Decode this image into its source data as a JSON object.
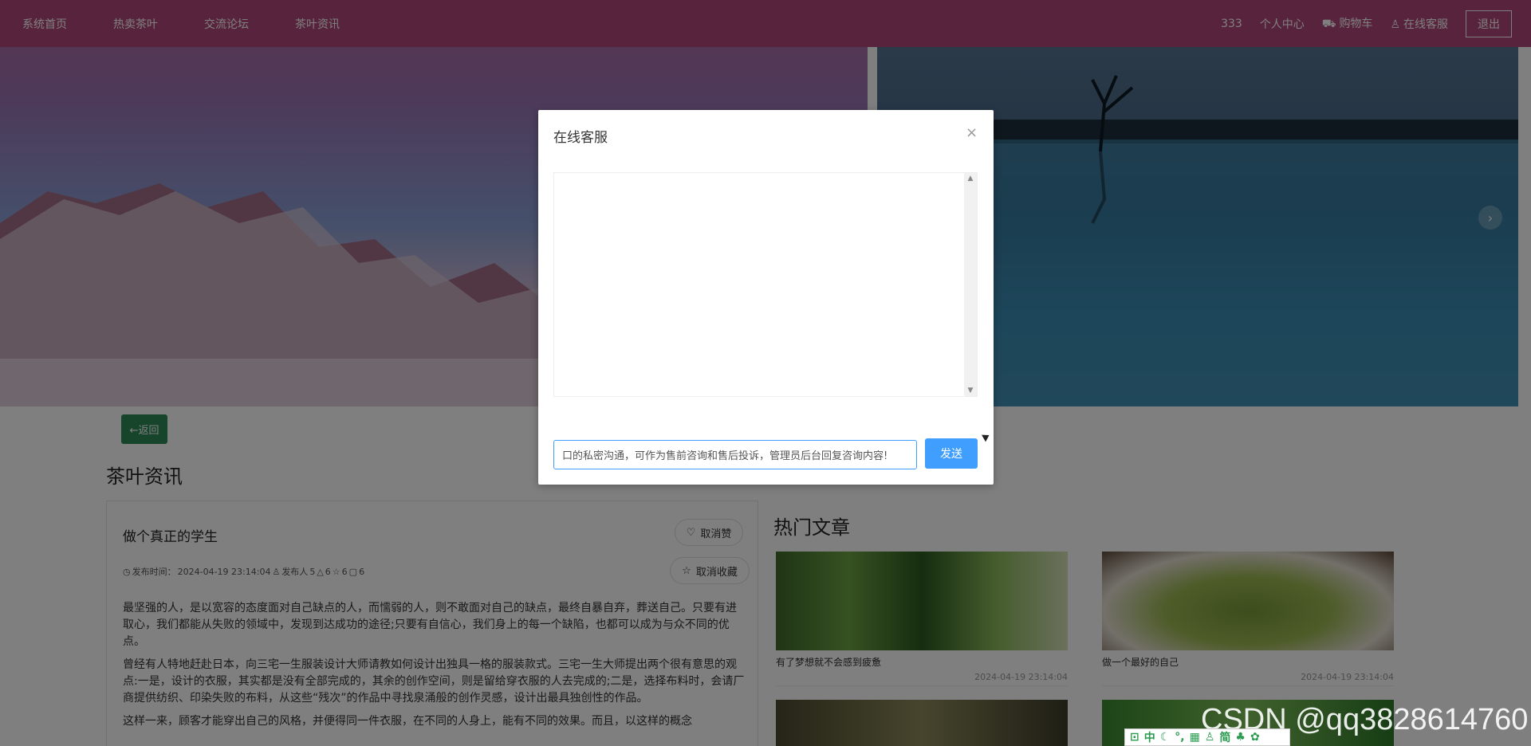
{
  "nav": {
    "links": [
      "系统首页",
      "热卖茶叶",
      "交流论坛",
      "茶叶资讯"
    ],
    "user_id": "333",
    "profile": "个人中心",
    "cart": "购物车",
    "service": "在线客服",
    "logout": "退出"
  },
  "page": {
    "back_label": "←返回",
    "section_title": "茶叶资讯"
  },
  "article": {
    "title": "做个真正的学生",
    "unlike_label": "取消赞",
    "uncollect_label": "取消收藏",
    "meta": {
      "publish_label": "发布时间：",
      "publish_time": "2024-04-19 23:14:04",
      "author_label": "发布人",
      "author": "5",
      "likes": "6",
      "favorites": "6",
      "comments": "6"
    },
    "paragraphs": [
      "最坚强的人，是以宽容的态度面对自己缺点的人，而懦弱的人，则不敢面对自己的缺点，最终自暴自弃，葬送自己。只要有进取心，我们都能从失败的领域中，发现到达成功的途径;只要有自信心，我们身上的每一个缺陷，也都可以成为与众不同的优点。",
      "曾经有人特地赶赴日本，向三宅一生服装设计大师请教如何设计出独具一格的服装款式。三宅一生大师提出两个很有意思的观点:一是，设计的衣服，其实都是没有全部完成的，其余的创作空间，则是留给穿衣服的人去完成的;二是，选择布料时，会请厂商提供纺织、印染失败的布料，从这些“残次”的作品中寻找泉涌般的创作灵感，设计出最具独创性的作品。",
      "这样一来，顾客才能穿出自己的风格，并便得同一件衣服，在不同的人身上，能有不同的效果。而且，以这样的概念"
    ]
  },
  "hot": {
    "title": "热门文章",
    "items": [
      {
        "caption": "有了梦想就不会感到疲惫",
        "date": "2024-04-19 23:14:04"
      },
      {
        "caption": "做一个最好的自己",
        "date": "2024-04-19 23:14:04"
      }
    ]
  },
  "modal": {
    "title": "在线客服",
    "close": "×",
    "input_value": "口的私密沟通，可作为售前咨询和售后投诉，管理员后台回复咨询内容!",
    "send_label": "发送"
  },
  "watermark": "CSDN @qq3828614760",
  "ime": {
    "items": [
      "中",
      "简"
    ]
  },
  "colors": {
    "nav": "#b0487a",
    "primary": "#409eff",
    "back_button": "#2e8b57"
  },
  "icons": {
    "cart": "cart-icon",
    "service": "bell-icon",
    "close": "close-icon",
    "heart": "heart-icon",
    "star": "star-icon",
    "clock": "clock-icon"
  }
}
